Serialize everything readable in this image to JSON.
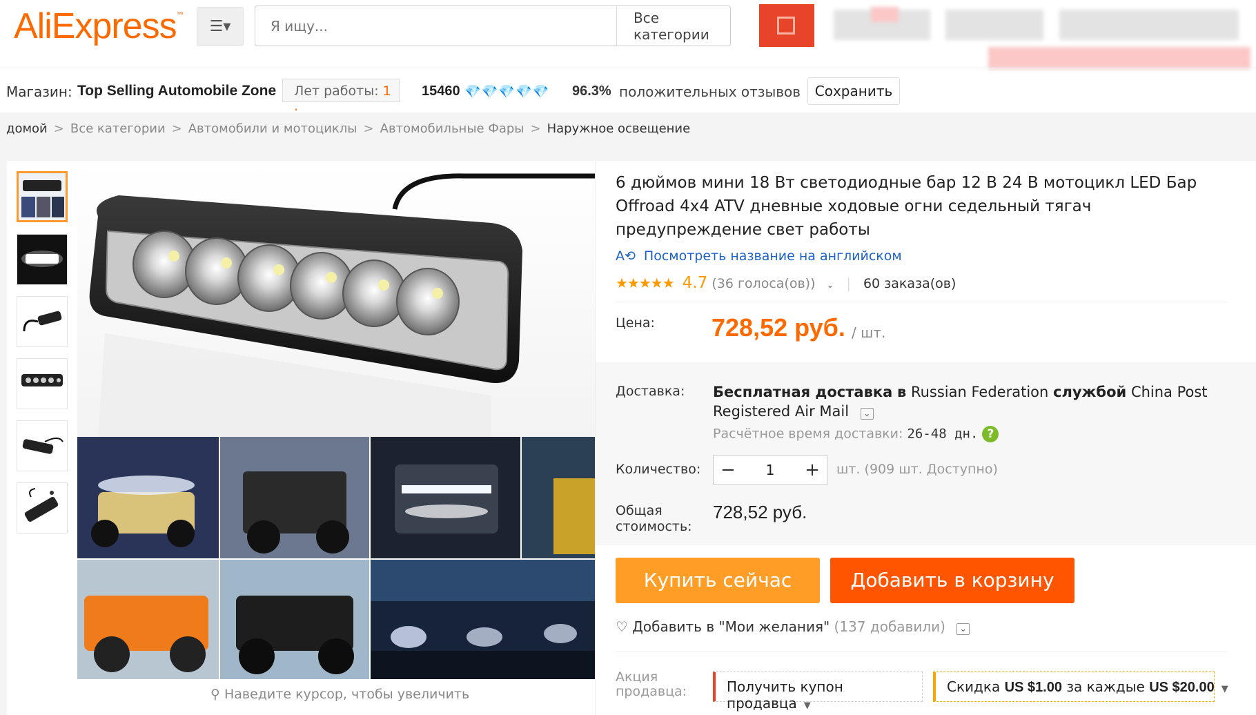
{
  "header": {
    "logo_text": "AliExpress",
    "logo_tm": "™",
    "search_placeholder": "Я ищу...",
    "search_category": "Все категории"
  },
  "store": {
    "label": "Магазин:",
    "name": "Top Selling Automobile Zone",
    "years_label": "Лет работы:",
    "years_value": "1",
    "years_suffix": ".",
    "score": "15460",
    "diamonds": "💎💎💎💎💎",
    "positive_pct": "96.3%",
    "positive_label": "положительных отзывов",
    "save_label": "Сохранить"
  },
  "breadcrumb": [
    "домой",
    "Все категории",
    "Автомобили и мотоциклы",
    "Автомобильные Фары",
    "Наружное освещение"
  ],
  "breadcrumb_sep": ">",
  "gallery": {
    "zoom_hint": "Наведите курсор, чтобы увеличить",
    "thumb_count": 6
  },
  "product": {
    "title": "6 дюймов мини 18 Вт светодиодные бар 12 В 24 В мотоцикл LED Бар Offroad 4x4 ATV дневные ходовые огни седельный тягач предупреждение свет работы",
    "translate_link": "Посмотреть название на английском",
    "stars": "★★★★★",
    "rating": "4.7",
    "votes": "(36 голоса(ов))",
    "orders": "60 заказа(ов)",
    "price_label": "Цена:",
    "price": "728,52 руб.",
    "unit": "/ шт.",
    "shipping_label": "Доставка:",
    "shipping_free": "Бесплатная доставка",
    "shipping_to": "в",
    "shipping_country": "Russian Federation",
    "shipping_by": "службой",
    "shipping_carrier": "China Post Registered Air Mail",
    "eta_label": "Расчётное время доставки:",
    "eta_value": "26-48 дн.",
    "qty_label": "Количество:",
    "qty_minus": "−",
    "qty_value": "1",
    "qty_plus": "+",
    "availability": "шт. (909 шт. Доступно)",
    "total_label_1": "Общая",
    "total_label_2": "стоимость:",
    "total": "728,52 руб.",
    "buy_now": "Купить сейчас",
    "add_to_cart": "Добавить в корзину",
    "wishlist": "Добавить в \"Мои желания\"",
    "wishlist_count": "(137 добавили)",
    "promo_label_1": "Акция",
    "promo_label_2": "продавца:",
    "coupon": "Получить купон продавца",
    "discount_prefix": "Скидка",
    "discount_amount": "US $1.00",
    "discount_mid": "за каждые",
    "discount_threshold": "US $20.00"
  },
  "colors": {
    "brand": "#ff6a00",
    "buy": "#ff9d26",
    "cart": "#ff5400",
    "link": "#1a62c8",
    "search_button": "#e8442a"
  },
  "icons": [
    "menu-icon",
    "search-icon",
    "diamond-icon",
    "translate-icon",
    "heart-icon",
    "help-icon",
    "magnifier-icon"
  ]
}
